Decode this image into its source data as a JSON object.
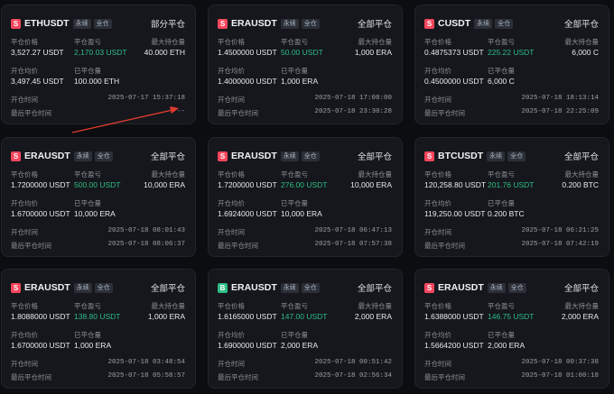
{
  "labels": {
    "close_price": "平仓价格",
    "close_pnl": "平仓盈亏",
    "max_position": "最大持仓量",
    "open_avg": "开仓均价",
    "closed_qty": "已平仓量",
    "open_time": "开仓时间",
    "last_close_time": "最后平仓时间"
  },
  "colors": {
    "sell": "#f6465d",
    "buy": "#2ebd85",
    "arrow": "#e23b2e"
  },
  "cards": [
    {
      "side": "sell",
      "side_letter": "S",
      "symbol": "ETHUSDT",
      "tags": [
        "永续",
        "全仓"
      ],
      "status": "部分平仓",
      "close_price": "3,527.27 USDT",
      "pnl": "2,170.03 USDT",
      "max_position": "40.000 ETH",
      "open_avg": "3,497.45 USDT",
      "closed_qty": "100.000 ETH",
      "open_time": "2025-07-17 15:37:18",
      "last_close_time": "--"
    },
    {
      "side": "sell",
      "side_letter": "S",
      "symbol": "ERAUSDT",
      "tags": [
        "永续",
        "全仓"
      ],
      "status": "全部平仓",
      "close_price": "1.4500000 USDT",
      "pnl": "50.00 USDT",
      "max_position": "1,000 ERA",
      "open_avg": "1.4000000 USDT",
      "closed_qty": "1,000 ERA",
      "open_time": "2025-07-18 17:08:00",
      "last_close_time": "2025-07-18 23:30:28"
    },
    {
      "side": "sell",
      "side_letter": "S",
      "symbol": "CUSDT",
      "tags": [
        "永续",
        "全仓"
      ],
      "status": "全部平仓",
      "close_price": "0.4875373 USDT",
      "pnl": "225.22 USDT",
      "max_position": "6,000 C",
      "open_avg": "0.4500000 USDT",
      "closed_qty": "6,000 C",
      "open_time": "2025-07-18 18:13:14",
      "last_close_time": "2025-07-18 22:25:09"
    },
    {
      "side": "sell",
      "side_letter": "S",
      "symbol": "ERAUSDT",
      "tags": [
        "永续",
        "全仓"
      ],
      "status": "全部平仓",
      "close_price": "1.7200000 USDT",
      "pnl": "500.00 USDT",
      "max_position": "10,000 ERA",
      "open_avg": "1.6700000 USDT",
      "closed_qty": "10,000 ERA",
      "open_time": "2025-07-18 08:01:43",
      "last_close_time": "2025-07-18 08:06:37"
    },
    {
      "side": "sell",
      "side_letter": "S",
      "symbol": "ERAUSDT",
      "tags": [
        "永续",
        "全仓"
      ],
      "status": "全部平仓",
      "close_price": "1.7200000 USDT",
      "pnl": "276.00 USDT",
      "max_position": "10,000 ERA",
      "open_avg": "1.6924000 USDT",
      "closed_qty": "10,000 ERA",
      "open_time": "2025-07-18 06:47:13",
      "last_close_time": "2025-07-18 07:57:38"
    },
    {
      "side": "sell",
      "side_letter": "S",
      "symbol": "BTCUSDT",
      "tags": [
        "永续",
        "全仓"
      ],
      "status": "全部平仓",
      "close_price": "120,258.80 USDT",
      "pnl": "201.76 USDT",
      "max_position": "0.200 BTC",
      "open_avg": "119,250.00 USDT",
      "closed_qty": "0.200 BTC",
      "open_time": "2025-07-18 06:21:25",
      "last_close_time": "2025-07-18 07:42:19"
    },
    {
      "side": "sell",
      "side_letter": "S",
      "symbol": "ERAUSDT",
      "tags": [
        "永续",
        "全仓"
      ],
      "status": "全部平仓",
      "close_price": "1.8088000 USDT",
      "pnl": "138.80 USDT",
      "max_position": "1,000 ERA",
      "open_avg": "1.6700000 USDT",
      "closed_qty": "1,000 ERA",
      "open_time": "2025-07-18 03:48:54",
      "last_close_time": "2025-07-18 05:58:57"
    },
    {
      "side": "buy",
      "side_letter": "B",
      "symbol": "ERAUSDT",
      "tags": [
        "永续",
        "全仓"
      ],
      "status": "全部平仓",
      "close_price": "1.6165000 USDT",
      "pnl": "147.00 USDT",
      "max_position": "2,000 ERA",
      "open_avg": "1.6900000 USDT",
      "closed_qty": "2,000 ERA",
      "open_time": "2025-07-18 00:51:42",
      "last_close_time": "2025-07-18 02:56:34"
    },
    {
      "side": "sell",
      "side_letter": "S",
      "symbol": "ERAUSDT",
      "tags": [
        "永续",
        "全仓"
      ],
      "status": "全部平仓",
      "close_price": "1.6388000 USDT",
      "pnl": "146.75 USDT",
      "max_position": "2,000 ERA",
      "open_avg": "1.5664200 USDT",
      "closed_qty": "2,000 ERA",
      "open_time": "2025-07-18 00:37:38",
      "last_close_time": "2025-07-18 01:00:18"
    }
  ]
}
